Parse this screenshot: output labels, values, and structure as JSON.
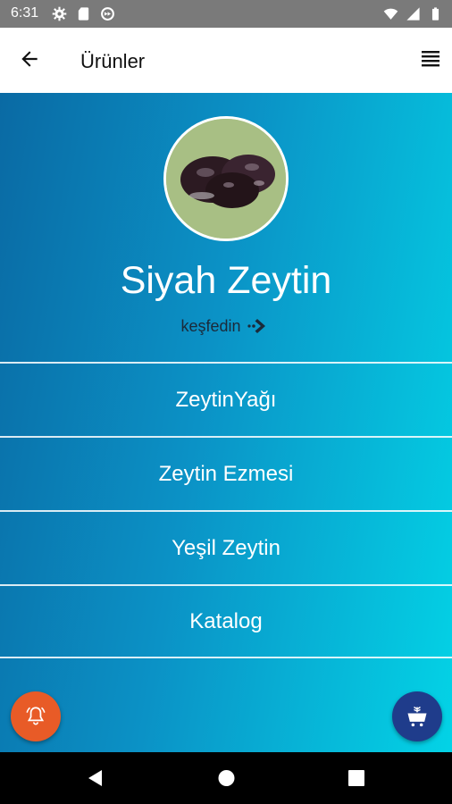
{
  "status_bar": {
    "time": "6:31"
  },
  "app_bar": {
    "title": "Ürünler"
  },
  "hero": {
    "title": "Siyah Zeytin",
    "explore_label": "keşfedin"
  },
  "menu": {
    "items": [
      {
        "label": "ZeytinYağı"
      },
      {
        "label": "Zeytin Ezmesi"
      },
      {
        "label": "Yeşil Zeytin"
      },
      {
        "label": "Katalog"
      }
    ]
  },
  "colors": {
    "gradient_start": "#0a6aa4",
    "gradient_end": "#03d3e6",
    "bell_fab": "#e85b27",
    "cart_fab": "#1f3c8b"
  },
  "icons": [
    "settings-icon",
    "sd-card-icon",
    "sync-icon",
    "wifi-icon",
    "signal-icon",
    "battery-icon",
    "back-arrow-icon",
    "menu-icon",
    "arrow-right-icon",
    "bell-icon",
    "cart-icon"
  ]
}
